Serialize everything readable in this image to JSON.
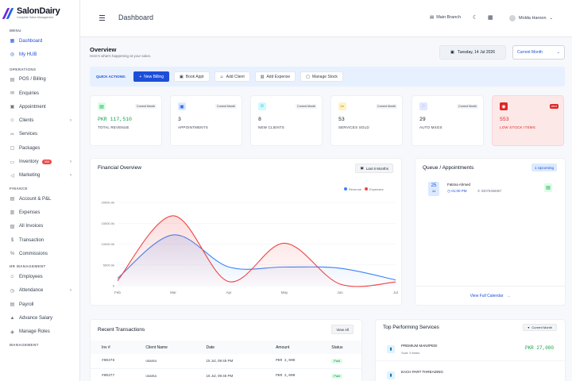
{
  "app": {
    "logo_title": "SalonDairy",
    "logo_subtitle": "Complete Salon Management"
  },
  "sidebar": {
    "sections": [
      {
        "label": "MENU",
        "items": [
          {
            "label": "Dashboard",
            "icon": "dashboard-icon",
            "active": true
          },
          {
            "label": "My HUB",
            "icon": "hub-icon",
            "active": true
          }
        ]
      },
      {
        "label": "OPERATIONS",
        "items": [
          {
            "label": "POS / Billing",
            "icon": "pos-icon"
          },
          {
            "label": "Enquiries",
            "icon": "enquiries-icon"
          },
          {
            "label": "Appointment",
            "icon": "calendar-icon"
          },
          {
            "label": "Clients",
            "icon": "users-icon",
            "chevron": true
          },
          {
            "label": "Services",
            "icon": "scissors-icon"
          },
          {
            "label": "Packages",
            "icon": "package-icon"
          },
          {
            "label": "Inventory",
            "icon": "box-icon",
            "badge": "555",
            "chevron": true
          },
          {
            "label": "Marketing",
            "icon": "megaphone-icon",
            "chevron": true
          }
        ]
      },
      {
        "label": "FINANCE",
        "items": [
          {
            "label": "Account & P&L",
            "icon": "account-icon"
          },
          {
            "label": "Expenses",
            "icon": "expenses-icon"
          },
          {
            "label": "All Invoices",
            "icon": "invoice-icon"
          },
          {
            "label": "Transaction",
            "icon": "dollar-icon"
          },
          {
            "label": "Commissions",
            "icon": "commission-icon"
          }
        ]
      },
      {
        "label": "HR MANAGEMENT",
        "items": [
          {
            "label": "Employees",
            "icon": "employees-icon"
          },
          {
            "label": "Attendance",
            "icon": "attendance-icon",
            "chevron": true
          },
          {
            "label": "Payroll",
            "icon": "payroll-icon"
          },
          {
            "label": "Advance Salary",
            "icon": "advance-icon"
          },
          {
            "label": "Manage Roles",
            "icon": "roles-icon"
          }
        ]
      },
      {
        "label": "MANAGEMENT",
        "items": []
      }
    ]
  },
  "topbar": {
    "title": "Dashboard",
    "branch": "Main Branch",
    "user_name": "Molda Haroon"
  },
  "overview": {
    "title": "Overview",
    "subtitle": "Here's what's happening at your salon.",
    "date": "Tuesday, 14 Jul 2026",
    "period": "Current Month"
  },
  "quick_actions": {
    "label": "QUICK ACTIONS:",
    "buttons": [
      {
        "label": "New Billing",
        "icon": "plus-icon",
        "primary": true
      },
      {
        "label": "Book Appt",
        "icon": "calendar-icon"
      },
      {
        "label": "Add Client",
        "icon": "user-plus-icon"
      },
      {
        "label": "Add Expense",
        "icon": "expense-icon"
      },
      {
        "label": "Manage Stock",
        "icon": "stock-icon"
      }
    ]
  },
  "stats": [
    {
      "value": "PKR 117,510",
      "label": "TOTAL REVENUE",
      "tag": "Current Month",
      "icon": "money-icon",
      "color": "#16a34a",
      "bg": "#dcfce7"
    },
    {
      "value": "3",
      "label": "APPOINTMENTS",
      "tag": "Current Month",
      "icon": "calendar-icon",
      "color": "#2563eb",
      "bg": "#dbeafe"
    },
    {
      "value": "8",
      "label": "NEW CLIENTS",
      "tag": "Current Month",
      "icon": "users-icon",
      "color": "#0891b2",
      "bg": "#cffafe"
    },
    {
      "value": "53",
      "label": "SERVICES SOLD",
      "tag": "Current Month",
      "icon": "scissors-icon",
      "color": "#d97706",
      "bg": "#fef3c7"
    },
    {
      "value": "29",
      "label": "AUTO MSGS",
      "tag": "Current Month",
      "icon": "chat-icon",
      "color": "#4f46e5",
      "bg": "#e0e7ff"
    },
    {
      "value": "553",
      "label": "LOW STOCK ITEMS",
      "tag": "Alert",
      "icon": "alert-icon",
      "color": "#dc2626",
      "bg": "#dc2626",
      "alert": true
    }
  ],
  "financial": {
    "title": "Financial Overview",
    "range": "Last 6 Months"
  },
  "chart_data": {
    "type": "line",
    "categories": [
      "Feb",
      "Mar",
      "Apr",
      "May",
      "Jun",
      "Jul"
    ],
    "y_ticks": [
      "0",
      "5000.0k",
      "10000.0k",
      "15000.0k",
      "20000.0k"
    ],
    "ylim": [
      0,
      20000
    ],
    "series": [
      {
        "name": "Revenue",
        "color": "#3b82f6",
        "values": [
          1800,
          12200,
          4500,
          4500,
          4200,
          1400
        ]
      },
      {
        "name": "Expenses",
        "color": "#ef4444",
        "values": [
          1200,
          16800,
          1000,
          10200,
          400,
          900
        ]
      }
    ]
  },
  "queue": {
    "title": "Queue / Appointments",
    "upcoming": "1 Upcoming",
    "appointment": {
      "day": "25",
      "month": "Jul",
      "name": "Fatima Ahmed",
      "time": "01:00 PM",
      "phone": "03078456957"
    },
    "calendar_link": "View Full Calendar"
  },
  "transactions": {
    "title": "Recent Transactions",
    "view_all": "View All",
    "columns": [
      "Inv #",
      "Client Name",
      "Date",
      "Amount",
      "Status"
    ],
    "rows": [
      {
        "inv": "#00378",
        "client": "osama",
        "date": "15 Jul, 09:45 PM",
        "amount": "PKR 2,000",
        "status": "Paid"
      },
      {
        "inv": "#00377",
        "client": "osama",
        "date": "15 Jul, 09:45 PM",
        "amount": "PKR 2,000",
        "status": "Paid"
      }
    ]
  },
  "top_services": {
    "title": "Top Performing Services",
    "period": "Current Month",
    "items": [
      {
        "name": "PREMIUM MANI/PEDI",
        "sold": "Sold: 9 times",
        "price": "PKR 27,000"
      },
      {
        "name": "EACH PART THREADING",
        "sold": "",
        "price": ""
      }
    ]
  }
}
